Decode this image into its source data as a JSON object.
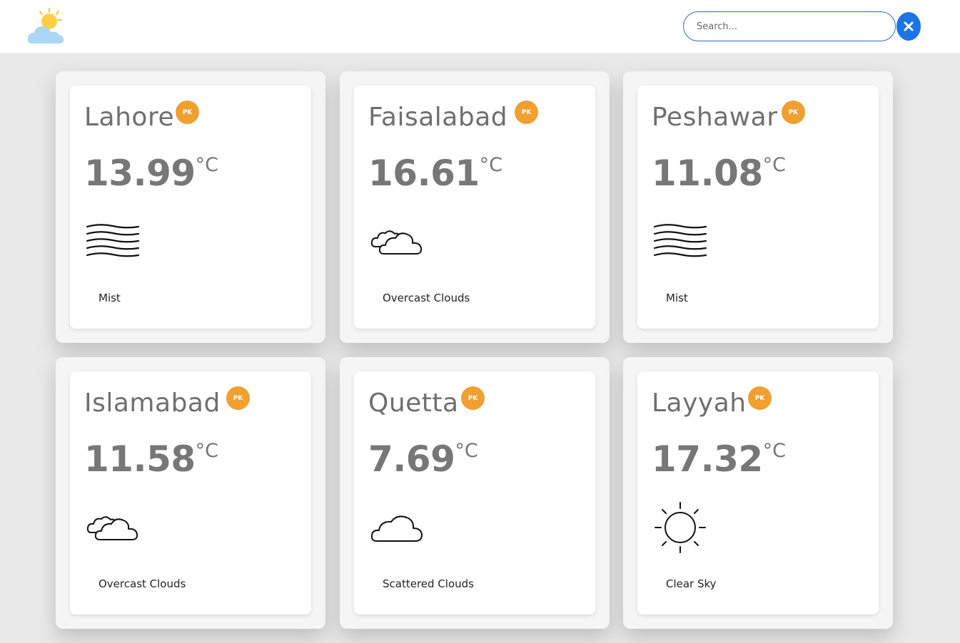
{
  "search": {
    "placeholder": "Search..."
  },
  "header": {
    "logo_icon": "weather-logo-icon",
    "clear_icon": "close-icon"
  },
  "colors": {
    "accent": "#1b74e8",
    "badge": "#f0a030",
    "background": "#e9e9e9"
  },
  "temp_unit": "°C",
  "cities": [
    {
      "name": "Lahore",
      "country": "PK",
      "temp": "13.99",
      "description": "Mist",
      "icon": "mist-icon"
    },
    {
      "name": "Faisalabad",
      "country": "PK",
      "temp": "16.61",
      "description": "Overcast Clouds",
      "icon": "overcast-clouds-icon"
    },
    {
      "name": "Peshawar",
      "country": "PK",
      "temp": "11.08",
      "description": "Mist",
      "icon": "mist-icon"
    },
    {
      "name": "Islamabad",
      "country": "PK",
      "temp": "11.58",
      "description": "Overcast Clouds",
      "icon": "overcast-clouds-icon"
    },
    {
      "name": "Quetta",
      "country": "PK",
      "temp": "7.69",
      "description": "Scattered Clouds",
      "icon": "scattered-clouds-icon"
    },
    {
      "name": "Layyah",
      "country": "PK",
      "temp": "17.32",
      "description": "Clear Sky",
      "icon": "clear-sky-icon"
    }
  ]
}
